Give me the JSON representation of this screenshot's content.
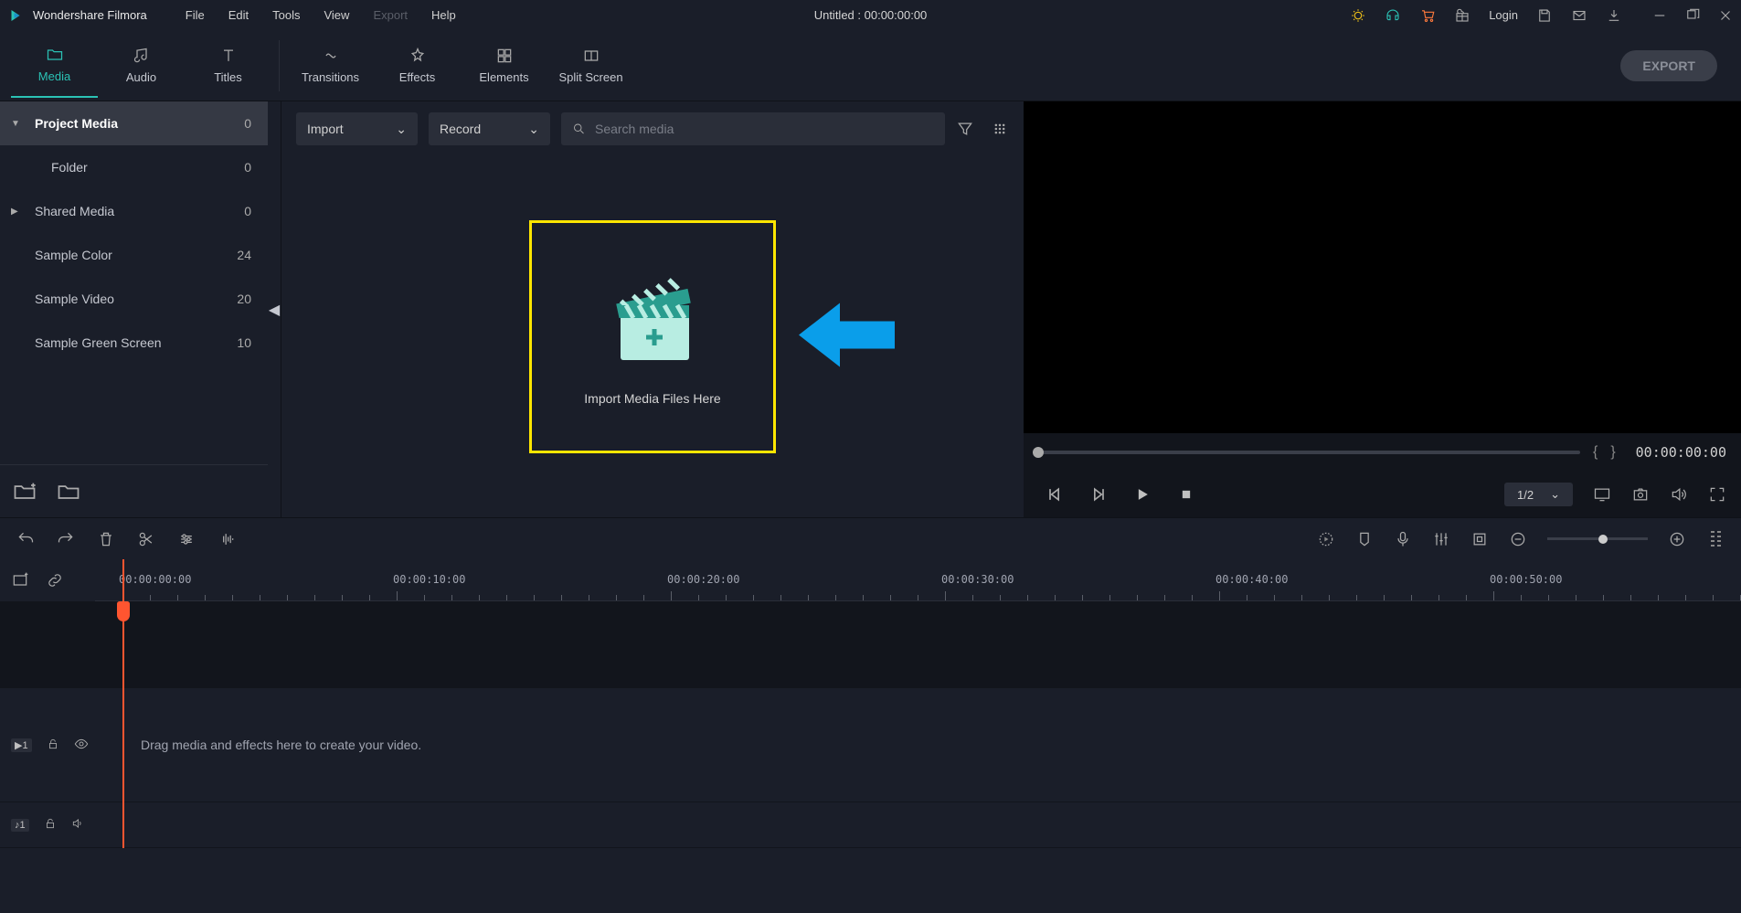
{
  "app": {
    "name": "Wondershare Filmora"
  },
  "menubar": [
    "File",
    "Edit",
    "Tools",
    "View",
    "Export",
    "Help"
  ],
  "title": "Untitled : 00:00:00:00",
  "login": "Login",
  "main_tabs": [
    {
      "label": "Media",
      "icon": "folder"
    },
    {
      "label": "Audio",
      "icon": "music"
    },
    {
      "label": "Titles",
      "icon": "text"
    },
    {
      "label": "Transitions",
      "icon": "transitions"
    },
    {
      "label": "Effects",
      "icon": "effects"
    },
    {
      "label": "Elements",
      "icon": "elements"
    },
    {
      "label": "Split Screen",
      "icon": "splitscreen"
    }
  ],
  "export_label": "EXPORT",
  "sidebar": {
    "items": [
      {
        "label": "Project Media",
        "count": 0,
        "arrow": "▼",
        "selected": true
      },
      {
        "label": "Folder",
        "count": 0,
        "indent": true
      },
      {
        "label": "Shared Media",
        "count": 0,
        "arrow": "▶"
      },
      {
        "label": "Sample Color",
        "count": 24
      },
      {
        "label": "Sample Video",
        "count": 20
      },
      {
        "label": "Sample Green Screen",
        "count": 10
      }
    ]
  },
  "media_toolbar": {
    "import": "Import",
    "record": "Record",
    "search_placeholder": "Search media"
  },
  "drop_text": "Import Media Files Here",
  "preview": {
    "time": "00:00:00:00",
    "scale": "1/2"
  },
  "timeline": {
    "ruler": [
      "00:00:00:00",
      "00:00:10:00",
      "00:00:20:00",
      "00:00:30:00",
      "00:00:40:00",
      "00:00:50:00"
    ],
    "track_video": "1",
    "track_audio": "1",
    "drag_hint": "Drag media and effects here to create your video."
  }
}
